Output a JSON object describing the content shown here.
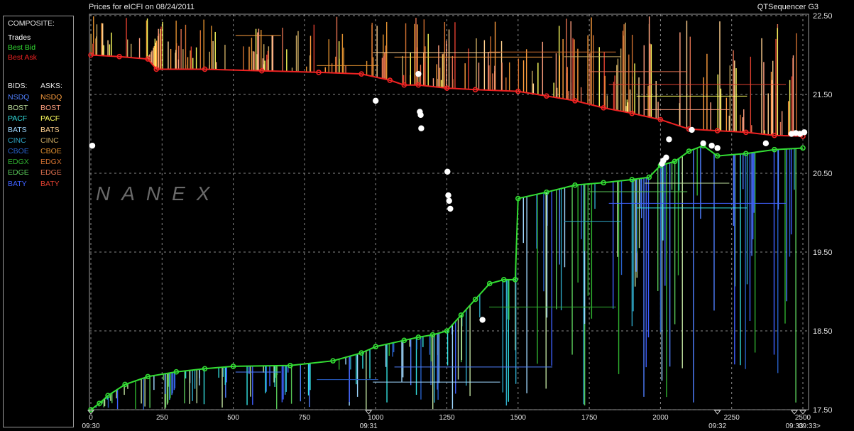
{
  "header": {
    "title": "Prices for  eICFI  on  08/24/2011",
    "app": "QTSequencer G3"
  },
  "legend": {
    "composite_title": "COMPOSITE:",
    "composite": [
      {
        "label": "Trades",
        "color": "#ffffff"
      },
      {
        "label": "Best Bid",
        "color": "#33dd33"
      },
      {
        "label": "Best Ask",
        "color": "#ee2222"
      }
    ],
    "bids_title": "BIDS:",
    "asks_title": "ASKS:",
    "bids": [
      {
        "label": "NSDQ",
        "color": "#4f7fff"
      },
      {
        "label": "BOST",
        "color": "#bfe09f"
      },
      {
        "label": "PACF",
        "color": "#33e0e0"
      },
      {
        "label": "BATS",
        "color": "#9fd8ff"
      },
      {
        "label": "CINC",
        "color": "#2fa8c8"
      },
      {
        "label": "CBOE",
        "color": "#2860c8"
      },
      {
        "label": "EDGX",
        "color": "#2fb02f"
      },
      {
        "label": "EDGE",
        "color": "#58c858"
      },
      {
        "label": "BATY",
        "color": "#3f60ff"
      }
    ],
    "asks": [
      {
        "label": "NSDQ",
        "color": "#ff9f3f"
      },
      {
        "label": "BOST",
        "color": "#ff9f7f"
      },
      {
        "label": "PACF",
        "color": "#ffff5f"
      },
      {
        "label": "BATS",
        "color": "#ffd08f"
      },
      {
        "label": "CINC",
        "color": "#c8a860"
      },
      {
        "label": "CBOE",
        "color": "#e09030"
      },
      {
        "label": "EDGX",
        "color": "#d07030"
      },
      {
        "label": "EDGE",
        "color": "#e07050"
      },
      {
        "label": "BATY",
        "color": "#e04030"
      }
    ]
  },
  "watermark": "NANEX",
  "chart_data": {
    "type": "line",
    "title": "Prices for  eICFI  on  08/24/2011",
    "xlim": [
      0,
      2500
    ],
    "ylim": [
      17.5,
      22.5
    ],
    "x_ticks": [
      0,
      250,
      500,
      750,
      1000,
      1250,
      1500,
      1750,
      2000,
      2250,
      2500
    ],
    "x_tick_labels": [
      "0",
      "250",
      "500",
      "750",
      "1000",
      "1250",
      "1500",
      "1750",
      "2000",
      "2250",
      "2500"
    ],
    "y_ticks": [
      17.5,
      18.5,
      19.5,
      20.5,
      21.5,
      22.5
    ],
    "y_tick_labels": [
      "17.50",
      "18.50",
      "19.50",
      "20.50",
      "21.50",
      "22.50"
    ],
    "time_labels": [
      {
        "x": 0,
        "label": "09:30"
      },
      {
        "x": 975,
        "label": "09:31"
      },
      {
        "x": 2200,
        "label": "09:32"
      },
      {
        "x": 2470,
        "label": "09:33"
      },
      {
        "x": 2500,
        "label": "09:33>"
      }
    ],
    "grid": true,
    "series": [
      {
        "name": "Best Ask",
        "color": "#ee2222",
        "x": [
          0,
          100,
          200,
          230,
          400,
          600,
          800,
          950,
          1050,
          1100,
          1150,
          1250,
          1350,
          1500,
          1600,
          1700,
          1800,
          1900,
          2000,
          2100,
          2200,
          2300,
          2400,
          2500
        ],
        "y": [
          22.0,
          21.98,
          21.95,
          21.82,
          21.82,
          21.8,
          21.78,
          21.76,
          21.68,
          21.62,
          21.62,
          21.58,
          21.56,
          21.54,
          21.48,
          21.42,
          21.33,
          21.26,
          21.18,
          21.06,
          21.04,
          21.02,
          20.98,
          20.97
        ]
      },
      {
        "name": "Best Bid",
        "color": "#33dd33",
        "x": [
          0,
          30,
          60,
          120,
          200,
          300,
          400,
          500,
          700,
          850,
          950,
          1000,
          1100,
          1150,
          1200,
          1250,
          1300,
          1350,
          1400,
          1450,
          1490,
          1500,
          1600,
          1700,
          1800,
          1900,
          1960,
          2000,
          2050,
          2100,
          2150,
          2200,
          2300,
          2400,
          2500
        ],
        "y": [
          17.5,
          17.58,
          17.68,
          17.82,
          17.92,
          17.98,
          18.02,
          18.05,
          18.06,
          18.12,
          18.22,
          18.3,
          18.38,
          18.42,
          18.45,
          18.5,
          18.7,
          18.9,
          19.1,
          19.15,
          19.15,
          20.18,
          20.26,
          20.35,
          20.38,
          20.42,
          20.45,
          20.6,
          20.65,
          20.78,
          20.85,
          20.72,
          20.75,
          20.8,
          20.82
        ]
      },
      {
        "name": "Trades",
        "color": "#ffffff",
        "x": [
          5,
          1000,
          1150,
          1155,
          1158,
          1160,
          1252,
          1255,
          1258,
          1262,
          1375,
          2005,
          2010,
          2020,
          2030,
          2110,
          2150,
          2180,
          2200,
          2370,
          2460,
          2475,
          2490,
          2505
        ],
        "y": [
          20.85,
          21.42,
          21.76,
          21.28,
          21.24,
          21.07,
          20.52,
          20.22,
          20.15,
          20.05,
          18.64,
          20.62,
          20.66,
          20.7,
          20.93,
          21.05,
          20.88,
          20.85,
          20.82,
          20.88,
          21.0,
          21.01,
          21.0,
          21.02
        ]
      }
    ]
  }
}
